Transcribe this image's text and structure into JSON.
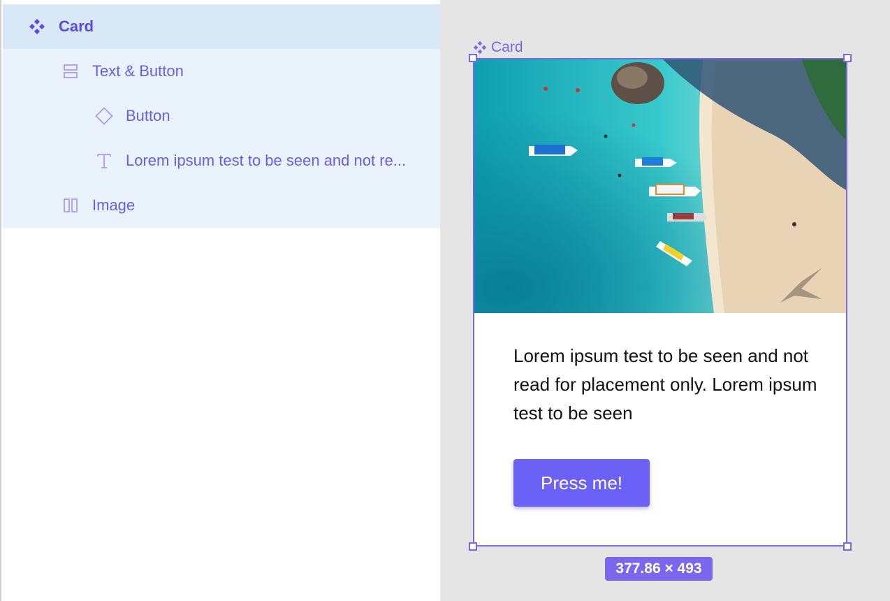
{
  "layers": {
    "items": [
      {
        "label": "Card",
        "icon": "component-icon"
      },
      {
        "label": "Text & Button",
        "icon": "vertical-stack-icon"
      },
      {
        "label": "Button",
        "icon": "instance-diamond-icon"
      },
      {
        "label": "Lorem ipsum test to be seen and not re...",
        "icon": "text-icon"
      },
      {
        "label": "Image",
        "icon": "horizontal-stack-icon"
      }
    ]
  },
  "canvas": {
    "frame_label": "Card",
    "card": {
      "image_icon": "beach-photo",
      "text": "Lorem ipsum test to be seen and not read for placement only. Lorem ipsum test to be seen",
      "button_label": "Press me!"
    },
    "dimensions": "377.86 × 493"
  },
  "colors": {
    "accent": "#7a67ee",
    "button": "#6c61f6",
    "selected_row": "#d9e8f6",
    "child_rows": "#eaf2fb",
    "canvas_bg": "#e5e5e5"
  }
}
